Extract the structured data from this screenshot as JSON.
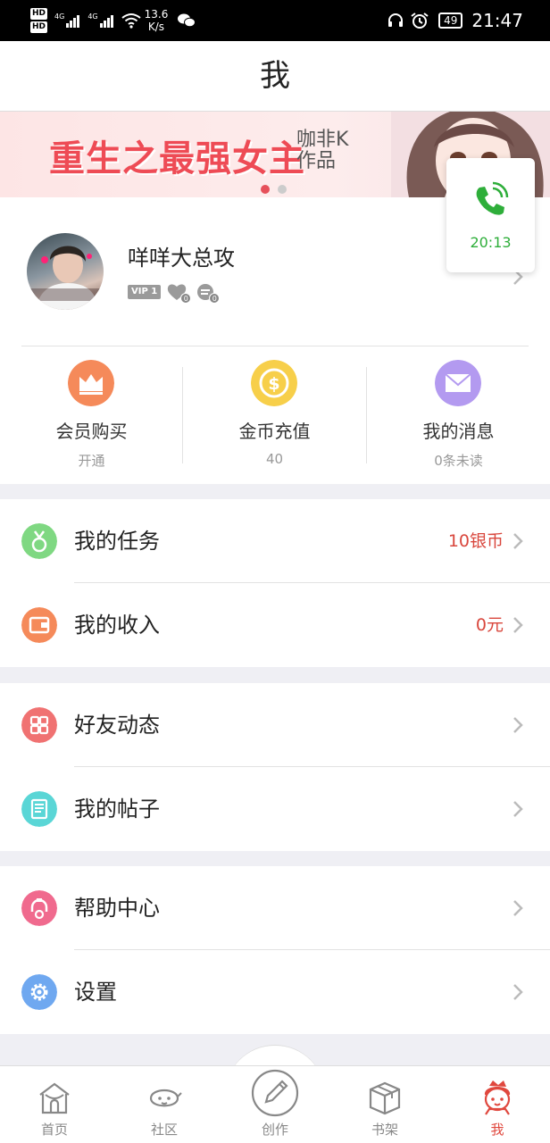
{
  "status_bar": {
    "hd1": "HD",
    "hd2": "HD",
    "net1": "4G",
    "net2": "4G",
    "speed_value": "13.6",
    "speed_unit": "K/s",
    "battery": "49",
    "time": "21:47"
  },
  "header": {
    "title": "我"
  },
  "banner": {
    "title": "重生之最强女主",
    "author": "咖非K作品",
    "active_slide": 1,
    "slide_count": 2
  },
  "floating_call": {
    "icon": "phone-icon",
    "time": "20:13",
    "color": "#2eae3a"
  },
  "profile": {
    "username": "咩咩大总攻",
    "vip_label": "VIP 1",
    "like_count": "0",
    "read_count": "0"
  },
  "quick_actions": [
    {
      "label": "会员购买",
      "sub": "开通",
      "icon": "crown-icon",
      "color": "#f58a5a"
    },
    {
      "label": "金币充值",
      "sub": "40",
      "icon": "coin-icon",
      "color": "#f7cf4a"
    },
    {
      "label": "我的消息",
      "sub": "0条未读",
      "icon": "envelope-icon",
      "color": "#b39af0"
    }
  ],
  "menu_groups": [
    [
      {
        "label": "我的任务",
        "value": "10银币",
        "icon": "medal-icon",
        "color": "#7fd882"
      },
      {
        "label": "我的收入",
        "value": "0元",
        "icon": "wallet-icon",
        "color": "#f58a5a"
      }
    ],
    [
      {
        "label": "好友动态",
        "value": "",
        "icon": "grid-icon",
        "color": "#f07272"
      },
      {
        "label": "我的帖子",
        "value": "",
        "icon": "document-icon",
        "color": "#5ad6d6"
      }
    ],
    [
      {
        "label": "帮助中心",
        "value": "",
        "icon": "headset-icon",
        "color": "#f06a8e"
      },
      {
        "label": "设置",
        "value": "",
        "icon": "gear-icon",
        "color": "#6fa8f0"
      }
    ]
  ],
  "tabs": [
    {
      "label": "首页",
      "icon": "home-tent-icon"
    },
    {
      "label": "社区",
      "icon": "community-face-icon"
    },
    {
      "label": "创作",
      "icon": "pencil-icon"
    },
    {
      "label": "书架",
      "icon": "bookshelf-box-icon"
    },
    {
      "label": "我",
      "icon": "profile-avatar-icon",
      "active": true
    }
  ],
  "colors": {
    "accent": "#e0483e",
    "value_red": "#d9473d",
    "call_green": "#2eae3a"
  }
}
